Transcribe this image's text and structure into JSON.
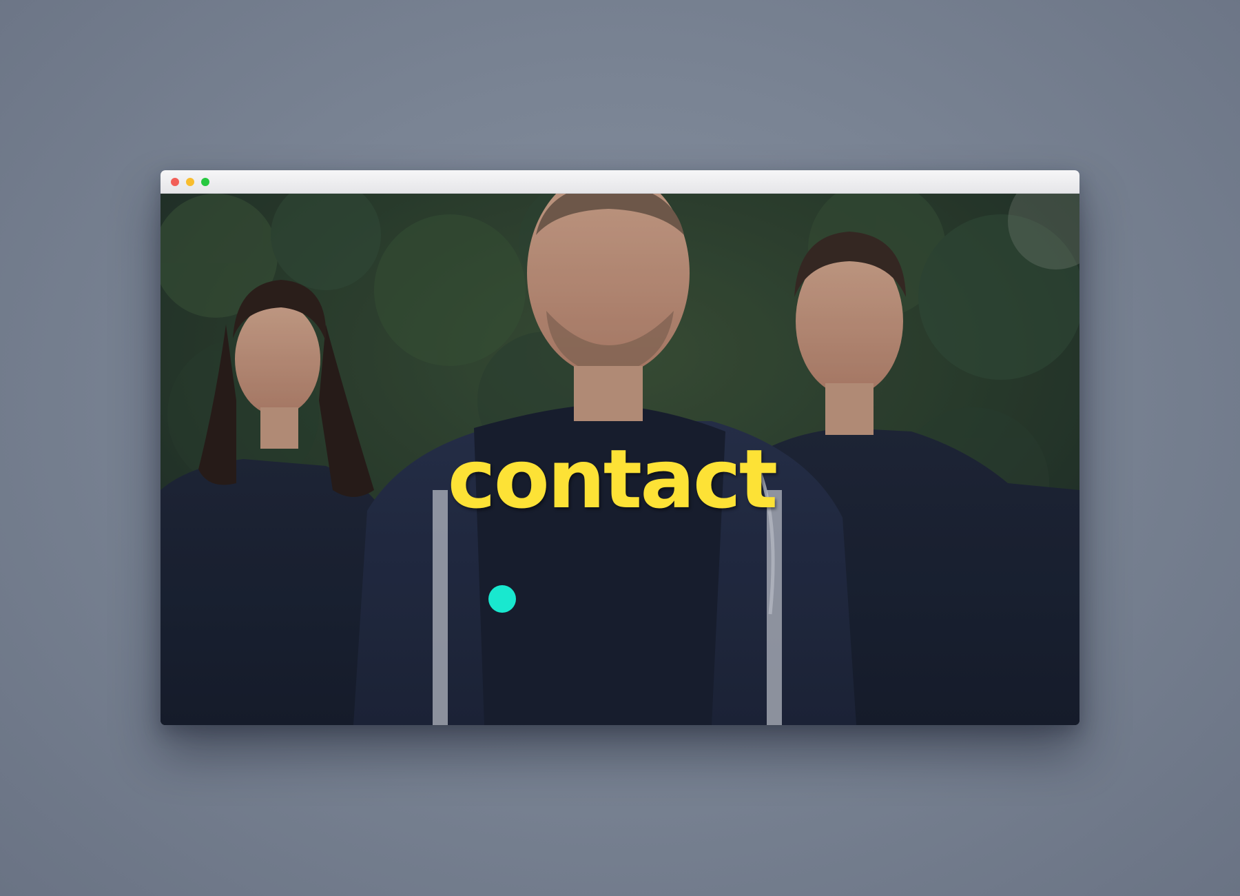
{
  "window": {
    "controls": [
      {
        "name": "close",
        "color": "#f25f58"
      },
      {
        "name": "minimize",
        "color": "#f8bd2e"
      },
      {
        "name": "maximize",
        "color": "#27c840"
      }
    ]
  },
  "hero": {
    "title": "contact",
    "title_color": "#fde236",
    "image": "band-photo",
    "cursor_color": "#19e8cf"
  }
}
